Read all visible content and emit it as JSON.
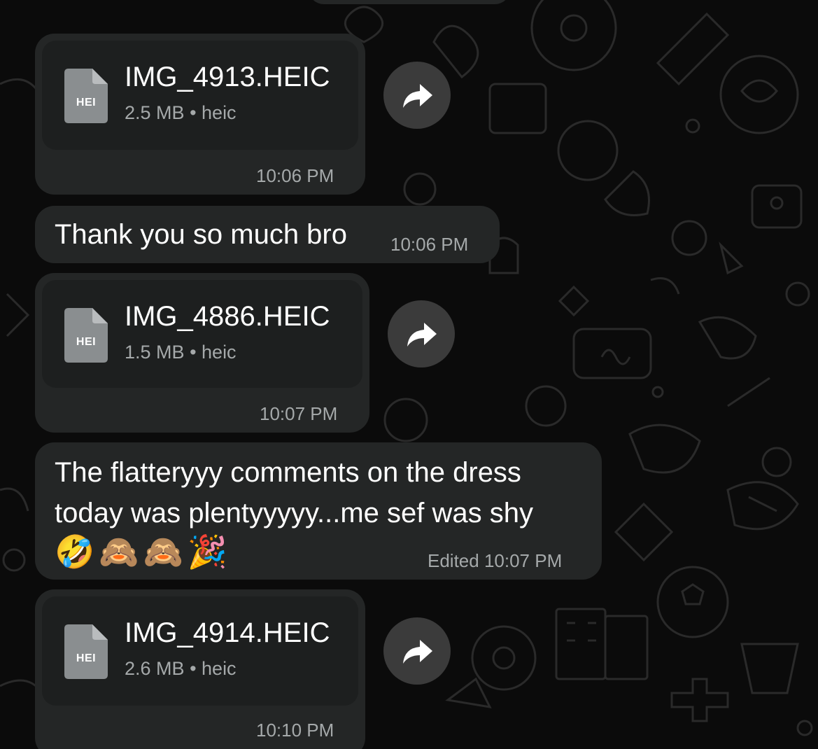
{
  "messages": [
    {
      "type": "file",
      "file_name": "IMG_4913.HEIC",
      "file_icon_label": "HEI",
      "file_size": "2.5 MB",
      "file_ext": "heic",
      "separator": "•",
      "time": "10:06 PM"
    },
    {
      "type": "text",
      "text": "Thank you so much bro",
      "time": "10:06 PM"
    },
    {
      "type": "file",
      "file_name": "IMG_4886.HEIC",
      "file_icon_label": "HEI",
      "file_size": "1.5 MB",
      "file_ext": "heic",
      "separator": "•",
      "time": "10:07 PM"
    },
    {
      "type": "text",
      "lines": [
        "The flatteryyy comments on the dress",
        "today was plentyyyyy...me sef was shy"
      ],
      "emojis": "🤣🙈🙈🎉",
      "time": "Edited 10:07 PM"
    },
    {
      "type": "file",
      "file_name": "IMG_4914.HEIC",
      "file_icon_label": "HEI",
      "file_size": "2.6 MB",
      "file_ext": "heic",
      "separator": "•",
      "time": "10:10 PM"
    }
  ],
  "colors": {
    "background": "#0b0b0b",
    "bubble": "#242626",
    "file_card": "#1d1f1f",
    "text": "#ffffff",
    "secondary_text": "#a5a9aa",
    "file_icon": "#8a8e90",
    "forward_button": "#3b3b3b"
  },
  "icons": {
    "forward": "forward-arrow-icon",
    "file": "document-icon"
  }
}
